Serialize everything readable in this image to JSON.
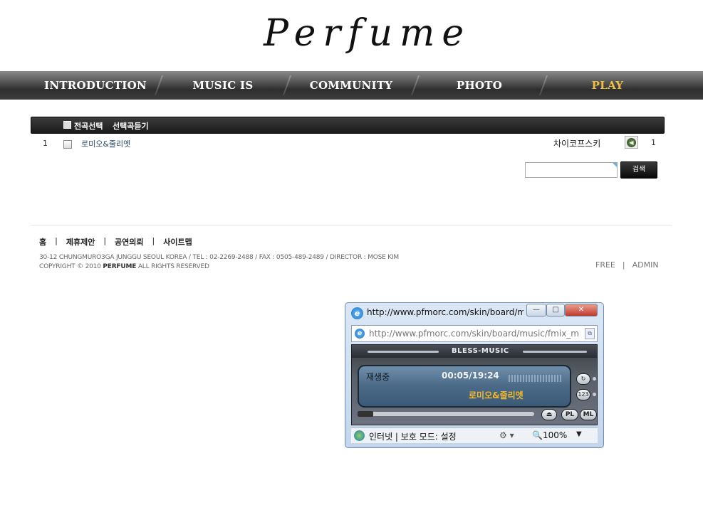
{
  "site": {
    "logo": "Perfume"
  },
  "nav": {
    "items": [
      {
        "label": "INTRODUCTION",
        "active": false
      },
      {
        "label": "MUSIC IS",
        "active": false
      },
      {
        "label": "COMMUNITY",
        "active": false
      },
      {
        "label": "PHOTO",
        "active": false
      },
      {
        "label": "PLAY",
        "active": true
      }
    ],
    "active_color": "#f0c040"
  },
  "list": {
    "header": {
      "select_all": "전곡선택",
      "play_selected": "선택곡듣기"
    },
    "rows": [
      {
        "num": "1",
        "title": "로미오&줄리엣",
        "artist": "차이코프스키",
        "count": "1"
      }
    ]
  },
  "search": {
    "value": "",
    "button": "검색"
  },
  "footer": {
    "links": [
      "홈",
      "제휴제안",
      "공연의뢰",
      "사이트맵"
    ],
    "address": "30-12 CHUNGMURO3GA JUNGGU SEOUL KOREA / TEL : 02-2269-2488 / FAX : 0505-489-2489 /  DIRECTOR : MOSE KIM",
    "copyright_pre": "COPYRIGHT © 2010 ",
    "copyright_brand": "PERFUME",
    "copyright_post": " ALL RIGHTS RESERVED",
    "right_links": [
      "FREE",
      "ADMIN"
    ]
  },
  "popup": {
    "title": "http://www.pfmorc.com/skin/board/mu...",
    "address": "http://www.pfmorc.com/skin/board/music/fmix_musi",
    "player": {
      "brand": "BLESS-MUSIC",
      "status": "재생중",
      "time": "00:05/19:24",
      "song": "로미오&줄리엣",
      "buttons": {
        "pl": "PL",
        "ml": "ML",
        "eject": "⏏",
        "repeat": "↻",
        "order": "123"
      }
    },
    "statusbar": {
      "text": "인터넷 | 보호 모드: 설정",
      "zoom": "100%"
    }
  }
}
